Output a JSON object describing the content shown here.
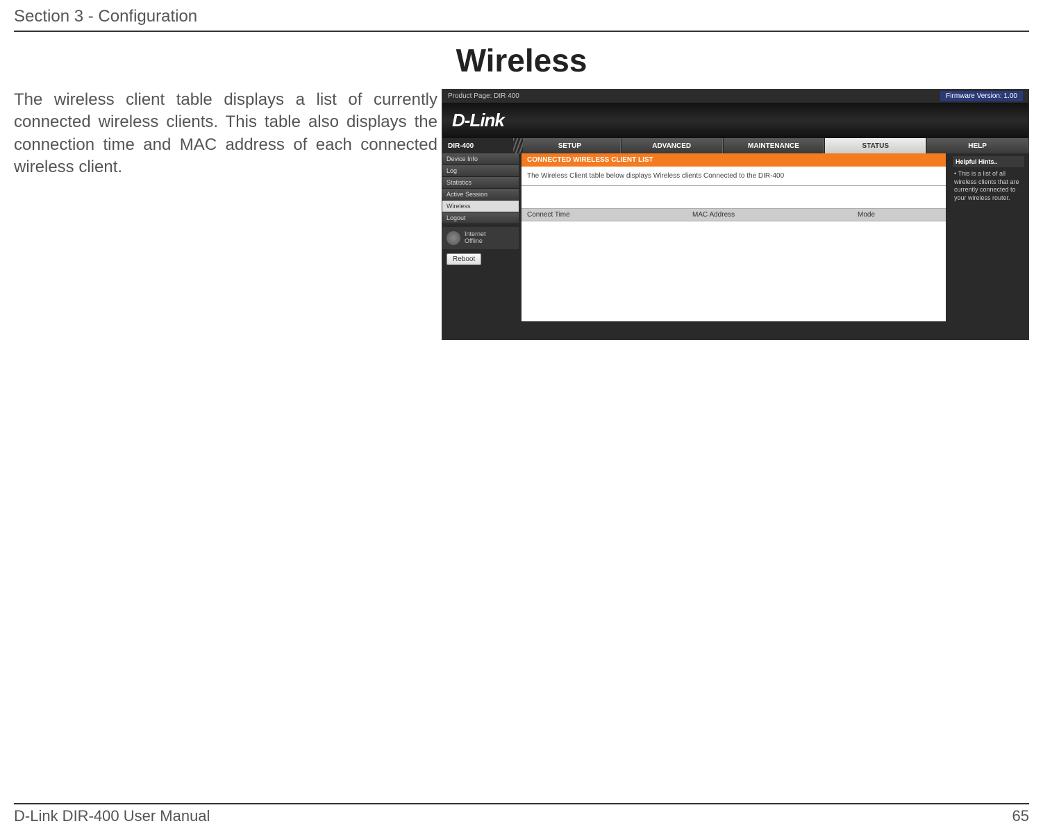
{
  "doc": {
    "section": "Section 3 - Configuration",
    "title": "Wireless",
    "body": "The wireless client table displays a list of currently connected wireless clients. This table also displays the connection time and MAC address of each connected wireless client.",
    "footer_left": "D-Link DIR-400 User Manual",
    "footer_right": "65"
  },
  "router": {
    "product_page": "Product Page: DIR 400",
    "firmware": "Firmware Version: 1.00",
    "brand": "D-Link",
    "model": "DIR-400",
    "tabs": [
      "SETUP",
      "ADVANCED",
      "MAINTENANCE",
      "STATUS",
      "HELP"
    ],
    "active_tab": "STATUS",
    "sidebar": [
      "Device Info",
      "Log",
      "Statistics",
      "Active Session",
      "Wireless",
      "Logout"
    ],
    "active_side": "Wireless",
    "internet_status_l1": "Internet",
    "internet_status_l2": "Offline",
    "reboot": "Reboot",
    "panel_header": "CONNECTED WIRELESS CLIENT LIST",
    "panel_desc": "The Wireless Client table below displays Wireless clients Connected to the DIR-400",
    "columns": [
      "Connect Time",
      "MAC Address",
      "Mode"
    ],
    "hints_title": "Helpful Hints..",
    "hints_body": "• This is a list of all wireless clients that are currently connected to your wireless router."
  }
}
